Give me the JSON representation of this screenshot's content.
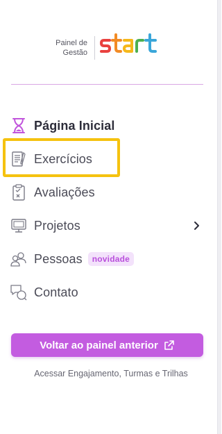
{
  "logo": {
    "line1": "Painel de",
    "line2": "Gestão",
    "brand": "start"
  },
  "nav": {
    "items": [
      {
        "label": "Página Inicial",
        "icon": "hourglass-icon"
      },
      {
        "label": "Exercícios",
        "icon": "document-icon"
      },
      {
        "label": "Avaliações",
        "icon": "clipboard-icon"
      },
      {
        "label": "Projetos",
        "icon": "monitor-icon"
      },
      {
        "label": "Pessoas",
        "icon": "people-icon",
        "badge": "novidade"
      },
      {
        "label": "Contato",
        "icon": "chat-icon"
      }
    ]
  },
  "cta": {
    "label": "Voltar ao painel anterior",
    "subtext": "Acessar Engajamento, Turmas e Trilhas"
  },
  "colors": {
    "accent": "#c35ce0",
    "highlight": "#f5c20f",
    "active_icon": "#c155dc"
  }
}
